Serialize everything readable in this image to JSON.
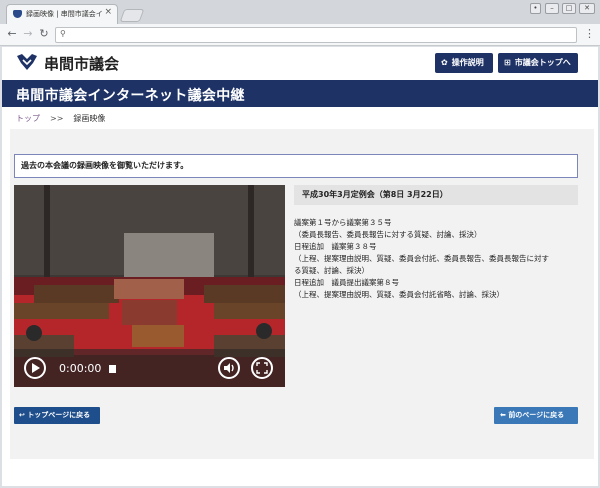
{
  "browser": {
    "tab_title": "録画映像 | 串間市議会イ",
    "close_glyph": "×",
    "address": "",
    "menu_glyph": "⋮"
  },
  "header": {
    "site_name": "串間市議会",
    "guide_button": "操作説明",
    "top_button": "市議会トップへ"
  },
  "banner": {
    "title": "串間市議会インターネット議会中継"
  },
  "breadcrumb": {
    "home": "トップ",
    "separator": ">>",
    "current": "録画映像"
  },
  "notice": "過去の本会議の録画映像を御覧いただけます。",
  "player": {
    "time": "0:00:00"
  },
  "session": {
    "heading": "平成30年3月定例会（第8日 3月22日）",
    "agenda": [
      "議案第１号から議案第３５号",
      "（委員長報告、委員長報告に対する質疑、討論、採決）",
      "日程追加　議案第３８号",
      "（上程、提案理由説明、質疑、委員会付託、委員長報告、委員長報告に対す",
      "る質疑、討論、採決）",
      "日程追加　議員提出議案第８号",
      "（上程、提案理由説明、質疑、委員会付託省略、討論、採決）"
    ]
  },
  "footer": {
    "back_top": "トップページに戻る",
    "back_prev": "前のページに戻る"
  },
  "colors": {
    "navy": "#1e3266",
    "button_blue": "#1f4e8c",
    "button_light_blue": "#3a78b8",
    "chamber_red": "#b5262b"
  }
}
